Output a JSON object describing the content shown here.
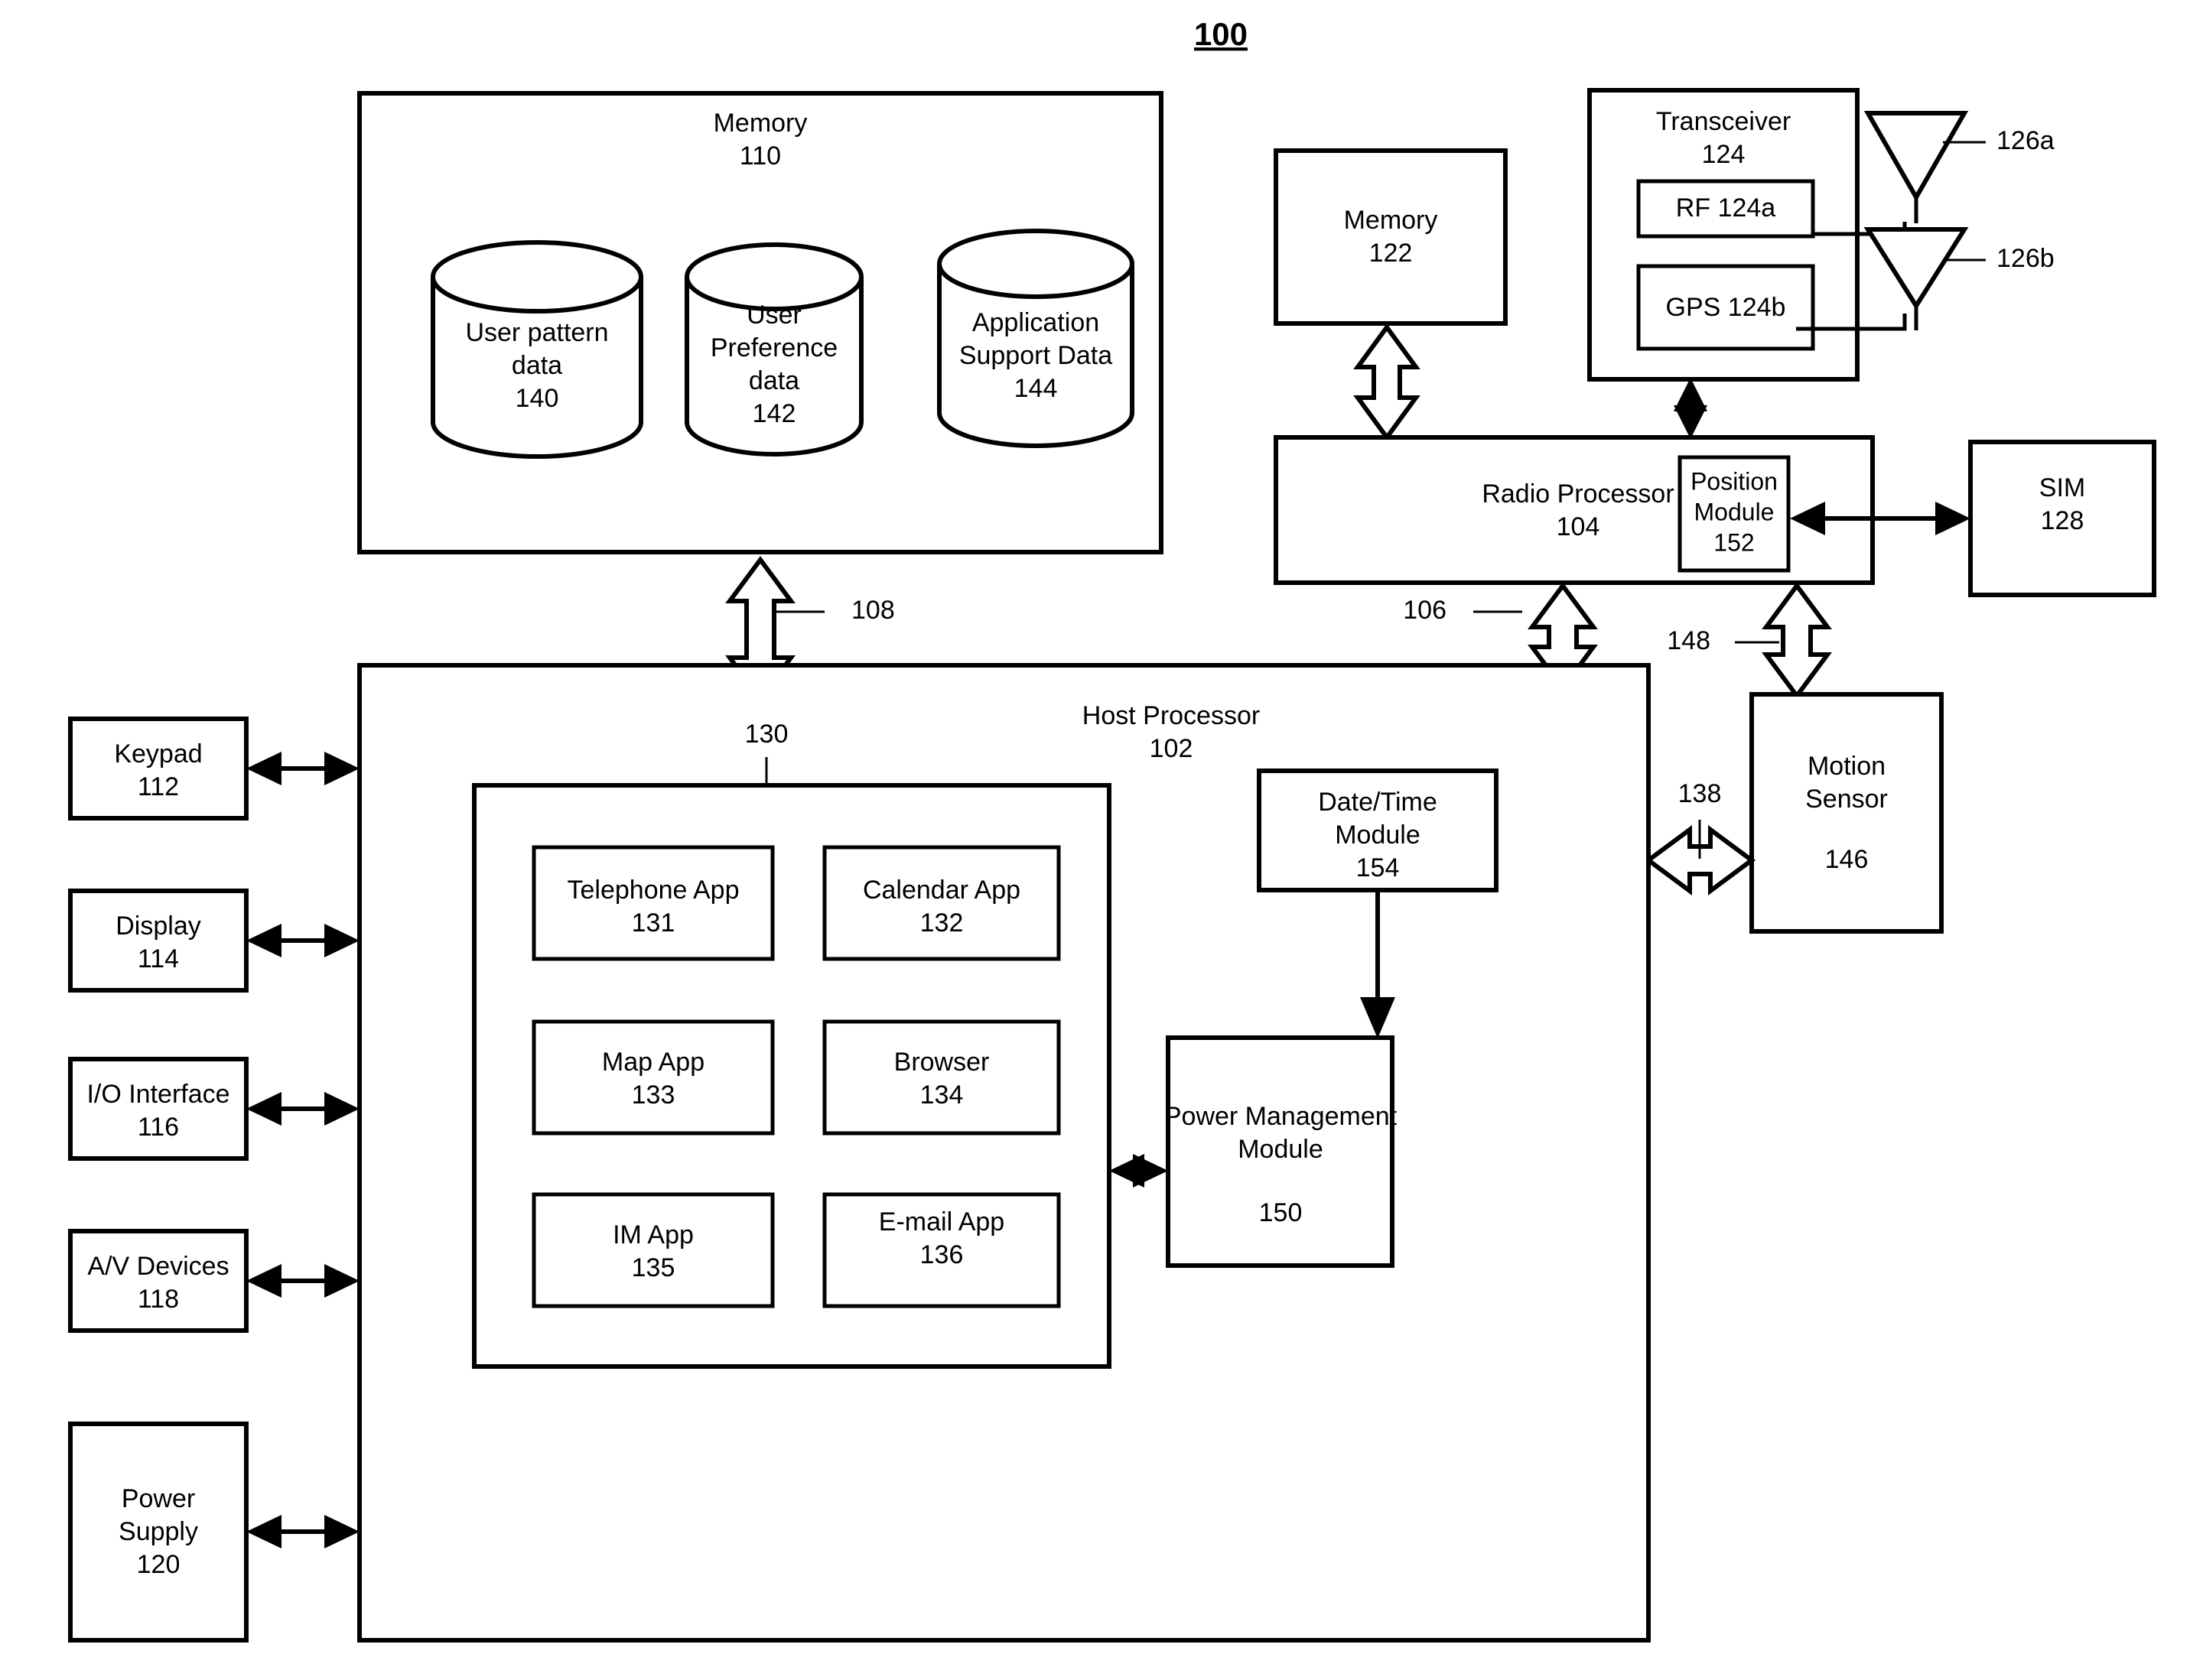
{
  "figure": {
    "number": "100",
    "type": "patent-block-diagram"
  },
  "blocks": {
    "memory_110": {
      "title": "Memory",
      "ref": "110"
    },
    "user_pattern_data": {
      "line1": "User pattern",
      "line2": "data",
      "ref": "140"
    },
    "user_preference_data": {
      "line1": "User",
      "line2": "Preference",
      "line3": "data",
      "ref": "142"
    },
    "application_support_data": {
      "line1": "Application",
      "line2": "Support Data",
      "ref": "144"
    },
    "memory_122": {
      "title": "Memory",
      "ref": "122"
    },
    "transceiver": {
      "title": "Transceiver",
      "ref": "124"
    },
    "rf": {
      "title": "RF 124a"
    },
    "gps": {
      "title": "GPS 124b"
    },
    "antenna_a": {
      "ref": "126a"
    },
    "antenna_b": {
      "ref": "126b"
    },
    "radio_processor": {
      "title": "Radio Processor",
      "ref": "104"
    },
    "position_module": {
      "line1": "Position",
      "line2": "Module",
      "ref": "152"
    },
    "sim": {
      "title": "SIM",
      "ref": "128"
    },
    "motion_sensor": {
      "line1": "Motion",
      "line2": "Sensor",
      "ref": "146"
    },
    "host_processor": {
      "title": "Host Processor",
      "ref": "102"
    },
    "applications_container": {
      "ref": "130"
    },
    "telephone_app": {
      "title": "Telephone App",
      "ref": "131"
    },
    "calendar_app": {
      "title": "Calendar App",
      "ref": "132"
    },
    "map_app": {
      "title": "Map App",
      "ref": "133"
    },
    "browser": {
      "title": "Browser",
      "ref": "134"
    },
    "im_app": {
      "title": "IM App",
      "ref": "135"
    },
    "email_app": {
      "title": "E-mail App",
      "ref": "136"
    },
    "date_time_module": {
      "line1": "Date/Time",
      "line2": "Module",
      "ref": "154"
    },
    "power_management_module": {
      "line1": "Power Management",
      "line2": "Module",
      "ref": "150"
    },
    "keypad": {
      "title": "Keypad",
      "ref": "112"
    },
    "display": {
      "title": "Display",
      "ref": "114"
    },
    "io_interface": {
      "title": "I/O Interface",
      "ref": "116"
    },
    "av_devices": {
      "title": "A/V Devices",
      "ref": "118"
    },
    "power_supply": {
      "line1": "Power",
      "line2": "Supply",
      "ref": "120"
    }
  },
  "connectors": {
    "bus_108": {
      "ref": "108"
    },
    "bus_106": {
      "ref": "106"
    },
    "bus_148": {
      "ref": "148"
    },
    "bus_138": {
      "ref": "138"
    }
  },
  "colors": {
    "stroke": "#000000",
    "fill": "#ffffff"
  }
}
